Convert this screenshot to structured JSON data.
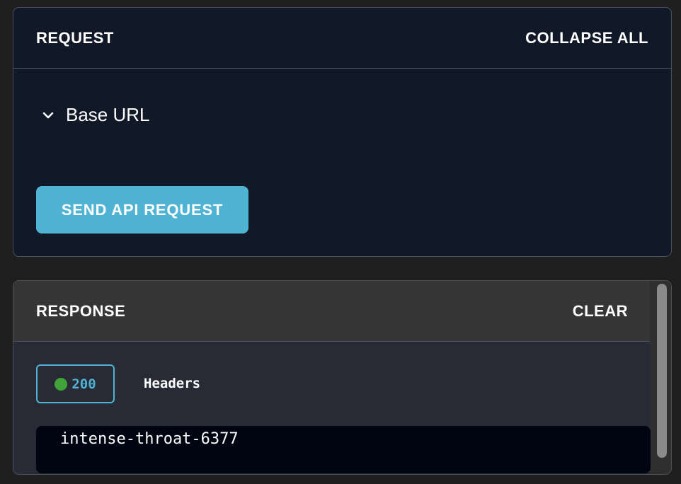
{
  "request": {
    "title": "REQUEST",
    "collapse_all_label": "COLLAPSE ALL",
    "base_url_label": "Base URL",
    "send_button_label": "SEND API REQUEST"
  },
  "response": {
    "title": "RESPONSE",
    "clear_label": "CLEAR",
    "status_code": "200",
    "headers_label": "Headers",
    "body_text": "intense-throat-6377"
  },
  "icons": {
    "expand": "chevron-down-icon",
    "status": "status-dot-icon"
  },
  "colors": {
    "accent": "#4fb3d4",
    "success": "#3fa33a",
    "panel_bg": "#111827",
    "response_header_bg": "#363636"
  }
}
